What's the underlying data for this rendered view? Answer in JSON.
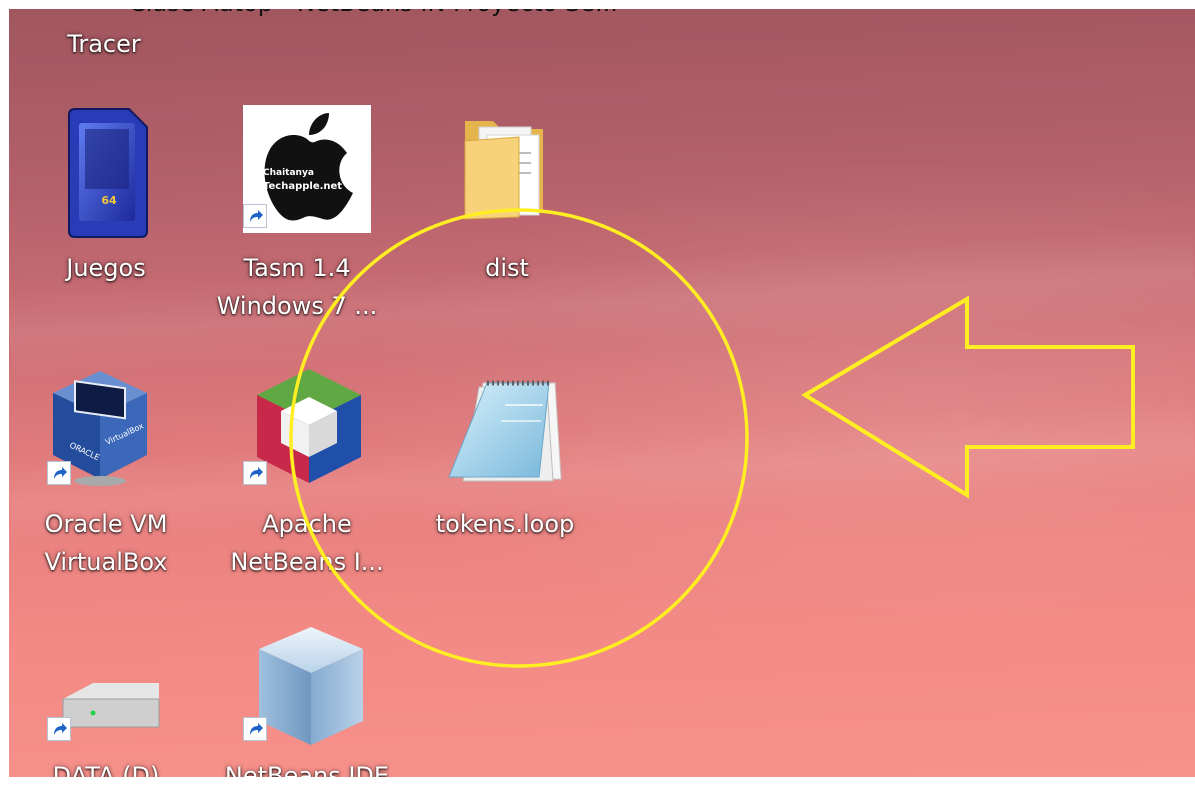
{
  "desktop": {
    "top_cut_label": "Clase Autop - NetBeans IN Proyecto Se...",
    "icons": {
      "tracer": {
        "label": "Tracer"
      },
      "juegos": {
        "label": "Juegos"
      },
      "tasm": {
        "line1": "Tasm 1.4",
        "line2": "Windows 7 ...",
        "image_line1": "Chaitanya",
        "image_line2": "Techapple.net"
      },
      "dist": {
        "label": "dist"
      },
      "virtualbox": {
        "line1": "Oracle VM",
        "line2": "VirtualBox"
      },
      "apache_netbeans": {
        "line1": "Apache",
        "line2": "NetBeans I..."
      },
      "tokens": {
        "label": "tokens.loop"
      },
      "data_drive": {
        "label": "DATA (D)"
      },
      "netbeans_ide": {
        "label": "NetBeans IDE"
      }
    }
  },
  "annotation": {
    "color": "#ffee22"
  }
}
